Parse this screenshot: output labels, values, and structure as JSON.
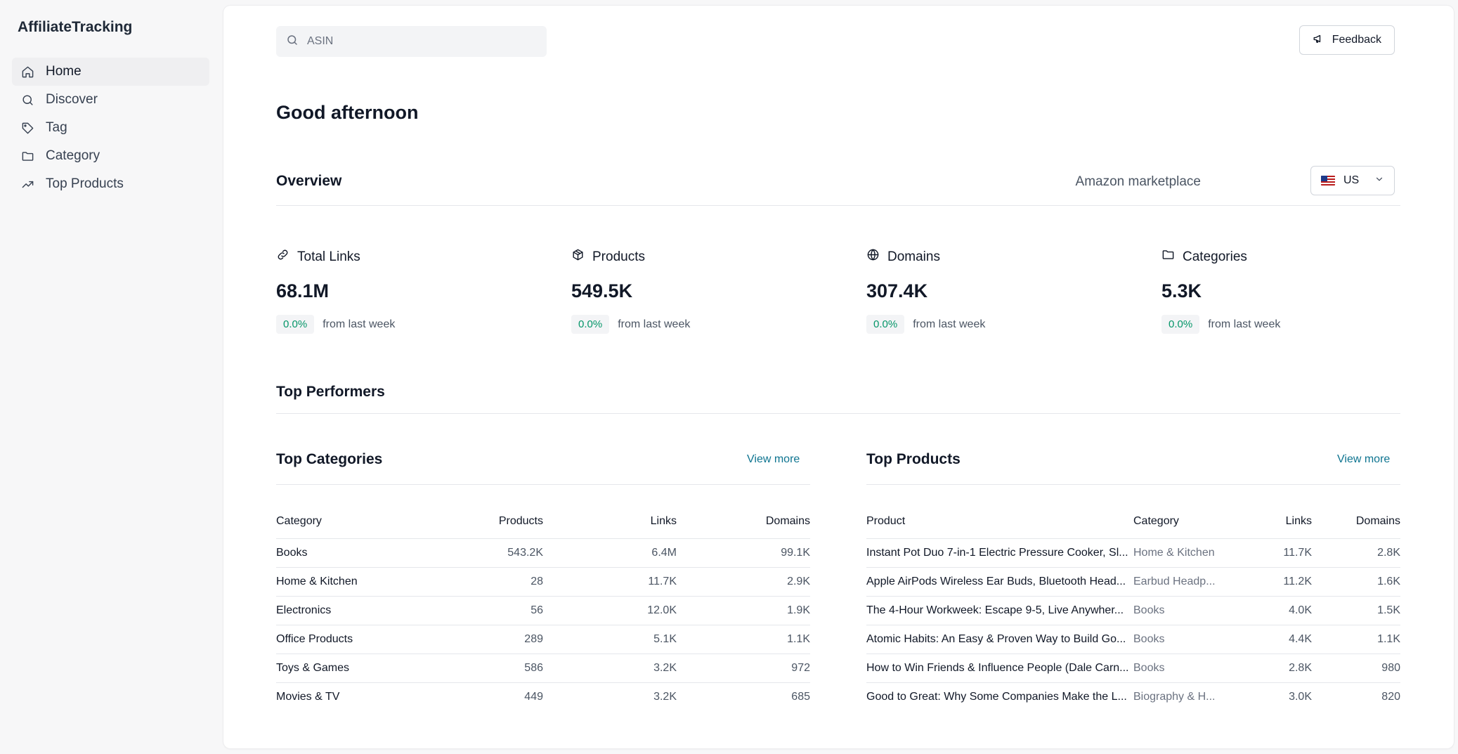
{
  "app": {
    "title": "AffiliateTracking"
  },
  "sidebar": {
    "items": [
      {
        "label": "Home",
        "icon": "home-icon",
        "active": true
      },
      {
        "label": "Discover",
        "icon": "search-icon"
      },
      {
        "label": "Tag",
        "icon": "tag-icon"
      },
      {
        "label": "Category",
        "icon": "folder-icon"
      },
      {
        "label": "Top Products",
        "icon": "trending-up-icon"
      }
    ]
  },
  "header": {
    "search_placeholder": "ASIN",
    "feedback_label": "Feedback"
  },
  "greeting": "Good afternoon",
  "overview": {
    "title": "Overview",
    "marketplace_label": "Amazon marketplace",
    "marketplace_value": "US",
    "stats": [
      {
        "label": "Total Links",
        "icon": "link-icon",
        "value": "68.1M",
        "change": "0.0%",
        "suffix": "from last week"
      },
      {
        "label": "Products",
        "icon": "package-icon",
        "value": "549.5K",
        "change": "0.0%",
        "suffix": "from last week"
      },
      {
        "label": "Domains",
        "icon": "globe-icon",
        "value": "307.4K",
        "change": "0.0%",
        "suffix": "from last week"
      },
      {
        "label": "Categories",
        "icon": "folder-icon",
        "value": "5.3K",
        "change": "0.0%",
        "suffix": "from last week"
      }
    ]
  },
  "top_performers": {
    "title": "Top Performers",
    "categories": {
      "title": "Top Categories",
      "view_more": "View more",
      "columns": [
        "Category",
        "Products",
        "Links",
        "Domains"
      ],
      "rows": [
        [
          "Books",
          "543.2K",
          "6.4M",
          "99.1K"
        ],
        [
          "Home & Kitchen",
          "28",
          "11.7K",
          "2.9K"
        ],
        [
          "Electronics",
          "56",
          "12.0K",
          "1.9K"
        ],
        [
          "Office Products",
          "289",
          "5.1K",
          "1.1K"
        ],
        [
          "Toys & Games",
          "586",
          "3.2K",
          "972"
        ],
        [
          "Movies & TV",
          "449",
          "3.2K",
          "685"
        ]
      ]
    },
    "products": {
      "title": "Top Products",
      "view_more": "View more",
      "columns": [
        "Product",
        "Category",
        "Links",
        "Domains"
      ],
      "rows": [
        [
          "Instant Pot Duo 7-in-1 Electric Pressure Cooker, Sl...",
          "Home & Kitchen",
          "11.7K",
          "2.8K"
        ],
        [
          "Apple AirPods Wireless Ear Buds, Bluetooth Head...",
          "Earbud Headp...",
          "11.2K",
          "1.6K"
        ],
        [
          "The 4-Hour Workweek: Escape 9-5, Live Anywher...",
          "Books",
          "4.0K",
          "1.5K"
        ],
        [
          "Atomic Habits: An Easy & Proven Way to Build Go...",
          "Books",
          "4.4K",
          "1.1K"
        ],
        [
          "How to Win Friends & Influence People (Dale Carn...",
          "Books",
          "2.8K",
          "980"
        ],
        [
          "Good to Great: Why Some Companies Make the L...",
          "Biography & H...",
          "3.0K",
          "820"
        ]
      ]
    }
  }
}
